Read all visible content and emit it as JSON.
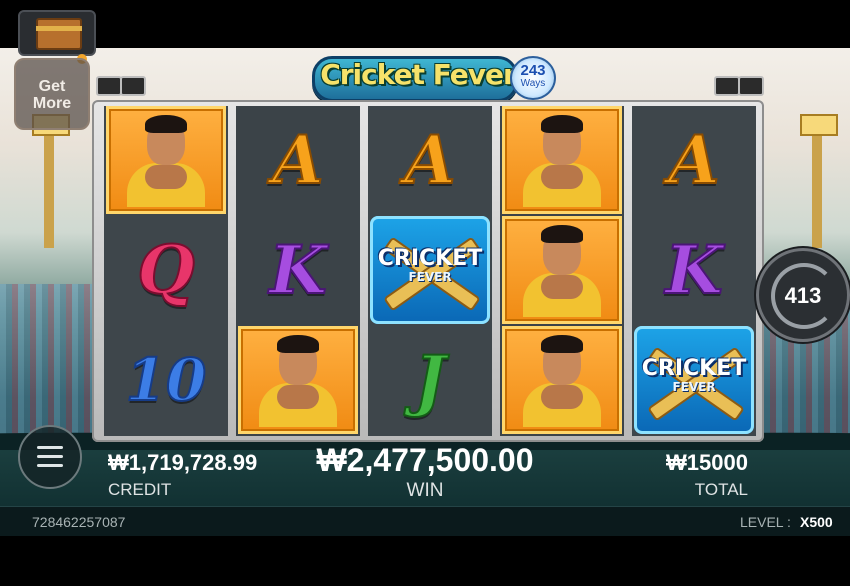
{
  "game": {
    "title": "Cricket Fever",
    "ways_number": "243",
    "ways_label": "Ways"
  },
  "buttons": {
    "get_more_line1": "Get",
    "get_more_line2": "More",
    "spin_count": "413"
  },
  "reels": [
    [
      "player",
      "Q",
      "10"
    ],
    [
      "A",
      "K",
      "player"
    ],
    [
      "A",
      "wild",
      "J"
    ],
    [
      "player",
      "player",
      "player"
    ],
    [
      "A",
      "K",
      "wild"
    ]
  ],
  "wild_symbol": {
    "line1": "CRICKET",
    "line2": "FEVER"
  },
  "balance": {
    "credit_value": "₩1,719,728.99",
    "credit_label": "CREDIT",
    "win_value": "₩2,477,500.00",
    "win_label": "WIN",
    "total_value": "₩15000",
    "total_label": "TOTAL"
  },
  "footer": {
    "round_id": "728462257087",
    "level_label": "LEVEL :",
    "level_value": "X500"
  },
  "colors": {
    "win_gold": "#ffffff",
    "accent_orange": "#f2a52b"
  }
}
